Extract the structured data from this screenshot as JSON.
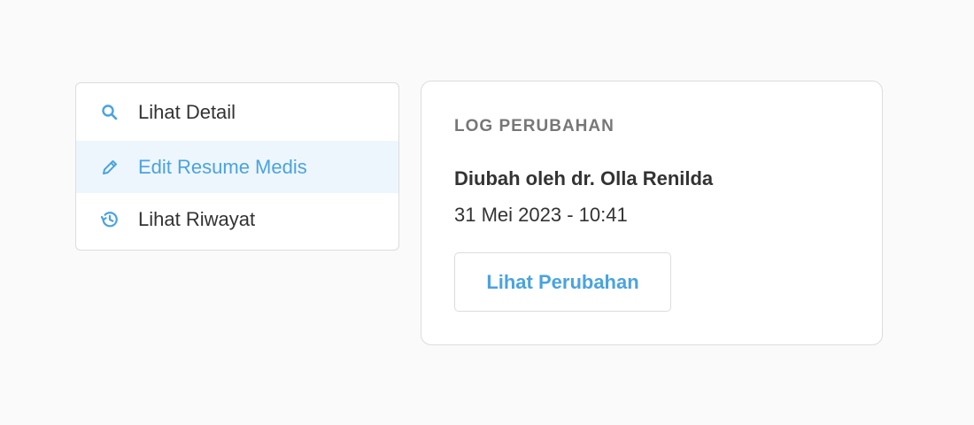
{
  "menu": {
    "items": [
      {
        "label": "Lihat Detail",
        "icon": "search-icon",
        "active": false
      },
      {
        "label": "Edit Resume Medis",
        "icon": "pencil-icon",
        "active": true
      },
      {
        "label": "Lihat Riwayat",
        "icon": "history-icon",
        "active": false
      }
    ]
  },
  "log": {
    "title": "LOG PERUBAHAN",
    "author": "Diubah oleh dr. Olla Renilda",
    "timestamp": "31 Mei 2023 - 10:41",
    "button_label": "Lihat Perubahan"
  },
  "colors": {
    "accent": "#4aa3df",
    "active_bg": "#eef6fd",
    "text": "#333333",
    "muted": "#777777",
    "border": "#dcdcdc",
    "page_bg": "#fafafa"
  }
}
